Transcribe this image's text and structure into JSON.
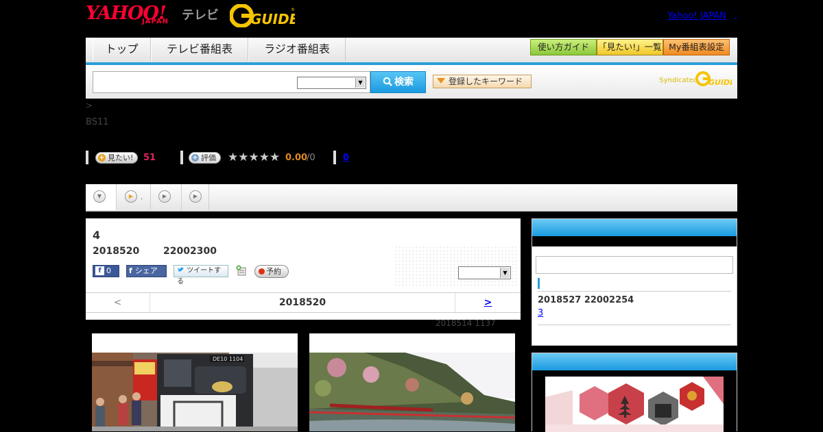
{
  "header": {
    "logo_yahoo": "YAHOO!",
    "logo_japan": "JAPAN",
    "logo_tv": "テレビ",
    "logo_gguide": "GUIDE",
    "yahoo_japan_link": "Yahoo! JAPAN",
    "link_sep": ","
  },
  "nav": {
    "tabs": [
      "トップ",
      "テレビ番組表",
      "ラジオ番組表"
    ],
    "buttons": [
      "使い方ガイド",
      "「見たい!」一覧",
      "My番組表設定"
    ]
  },
  "search": {
    "input_value": "",
    "select_value": "",
    "button_label": "検索",
    "keyword_button": "登録したキーワード",
    "syndicated": "Syndicated",
    "syndicated_logo": "GUIDE"
  },
  "breadcrumb": ">",
  "channel": "BS11",
  "stats": {
    "want_label": "見たい!",
    "want_count": "51",
    "rate_label": "評価",
    "stars": "★★★★★",
    "rating": "0.00",
    "rating_max": "/0",
    "review_count": "0"
  },
  "tabs": {
    "dot_label": "."
  },
  "program": {
    "title": "4",
    "date": "2018520",
    "time": "22002300",
    "fb_like_count": "0",
    "fb_share": "シェア",
    "tweet": "ツイートする",
    "reserve": "予約",
    "select_value": "",
    "pager_prev": "<",
    "pager_current": "2018520",
    "pager_next": ">",
    "updated": "2018514  1137"
  },
  "sidebar": {
    "next_date": "2018527  22002254",
    "next_link": "3"
  },
  "colors": {
    "accent_blue": "#2a9ed8",
    "yahoo_red": "#ff0033",
    "want_count_color": "#e0245e",
    "rating_color": "#e08a20"
  },
  "icons": {
    "search": "magnifier-icon",
    "play": "play-circle-icon",
    "dropdown": "chevron-down-icon"
  }
}
